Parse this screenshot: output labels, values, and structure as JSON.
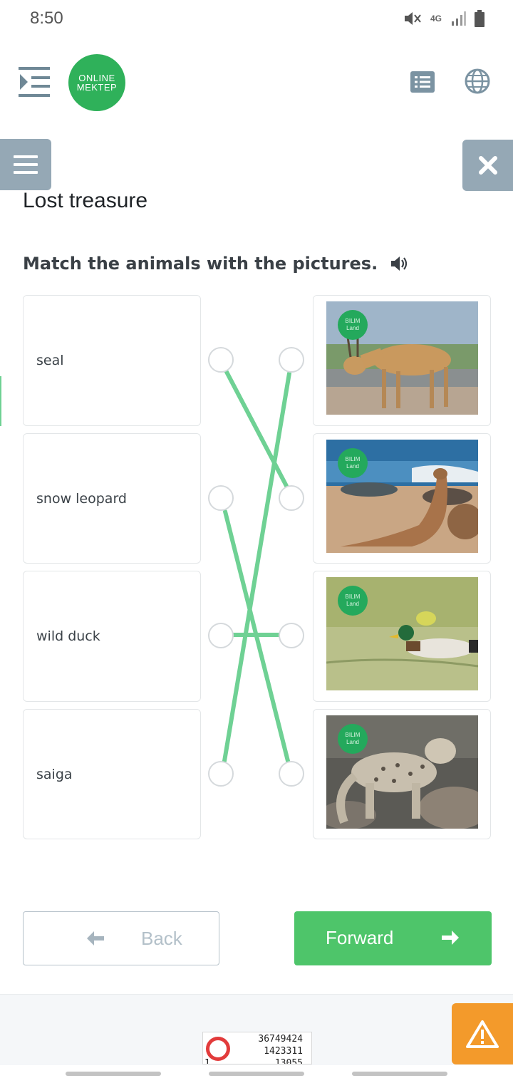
{
  "status": {
    "time": "8:50",
    "network": "4G",
    "icons": [
      "mute-icon",
      "signal-icon",
      "battery-icon"
    ]
  },
  "header": {
    "logo_line1": "ONLINE",
    "logo_line2": "MEKTEP",
    "icons": [
      "sidebar-toggle-icon",
      "list-icon",
      "globe-icon"
    ]
  },
  "lesson": {
    "title": "Lost treasure",
    "instruction": "Match the animals with the pictures."
  },
  "matching": {
    "words": [
      "seal",
      "snow leopard",
      "wild duck",
      "saiga"
    ],
    "pictures": [
      {
        "subject": "saiga",
        "badge_line1": "BILIM",
        "badge_line2": "Land"
      },
      {
        "subject": "seal",
        "badge_line1": "BILIM",
        "badge_line2": "Land"
      },
      {
        "subject": "wild duck",
        "badge_line1": "BILIM",
        "badge_line2": "Land"
      },
      {
        "subject": "snow leopard",
        "badge_line1": "BILIM",
        "badge_line2": "Land"
      }
    ],
    "connections": [
      {
        "word": "seal",
        "picture": "seal"
      },
      {
        "word": "snow leopard",
        "picture": "snow leopard"
      },
      {
        "word": "wild duck",
        "picture": "wild duck"
      },
      {
        "word": "saiga",
        "picture": "saiga"
      }
    ],
    "line_color": "#6fd194"
  },
  "nav": {
    "back_label": "Back",
    "forward_label": "Forward"
  },
  "footer": {
    "ad_numbers": [
      "36749424",
      "1423311",
      "13055",
      "1"
    ]
  },
  "colors": {
    "accent_green": "#4ec56a",
    "logo_green": "#2fb15a",
    "side_button": "#95a8b5",
    "warning": "#f39a2b"
  }
}
